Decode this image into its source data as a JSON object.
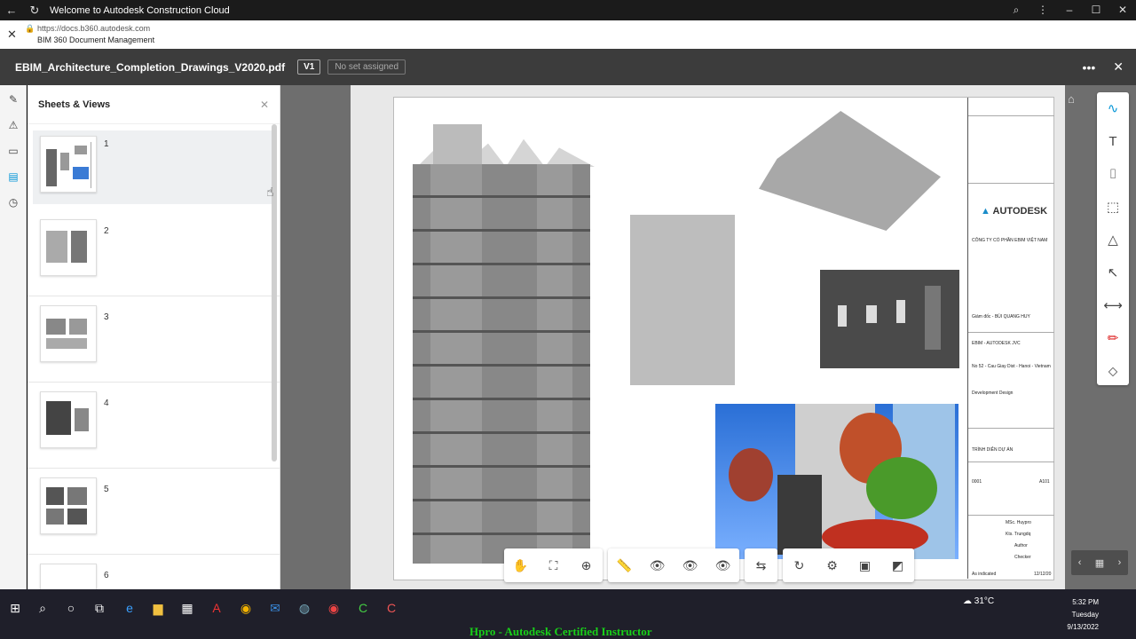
{
  "window": {
    "title": "Welcome to Autodesk Construction Cloud",
    "url": "https://docs.b360.autodesk.com",
    "site_name": "BIM 360 Document Management"
  },
  "header": {
    "file_name": "EBIM_Architecture_Completion_Drawings_V2020.pdf",
    "version": "V1",
    "set_status": "No set assigned"
  },
  "sidebar": {
    "title": "Sheets & Views",
    "sheets": [
      {
        "number": "1"
      },
      {
        "number": "2"
      },
      {
        "number": "3"
      },
      {
        "number": "4"
      },
      {
        "number": "5"
      },
      {
        "number": "6"
      }
    ]
  },
  "title_block": {
    "brand": "AUTODESK",
    "company": "CÔNG TY CỔ PHẦN EBIM VIỆT NAM",
    "director": "Giám đốc - BÙI QUANG HUY",
    "project": "EBIM - AUTODESK JVC",
    "location": "No 52 - Cau Giay Dist - Hanoi - Vietnam",
    "phase": "Development Design",
    "sheet_title": "TRÌNH DIỄN DỰ ÁN",
    "sheet_no": "A101",
    "date": "12/12/20",
    "project_no": "0001",
    "scale": "As indicated",
    "checked": "Checker",
    "author": "Author",
    "designer": "Kts. Trungdq",
    "owner": "MSc. Huypro"
  },
  "taskbar": {
    "weather": "31°C",
    "time": "5:32 PM",
    "day": "Tuesday",
    "date": "9/13/2022",
    "watermark": "Hpro - Autodesk Certified Instructor"
  }
}
